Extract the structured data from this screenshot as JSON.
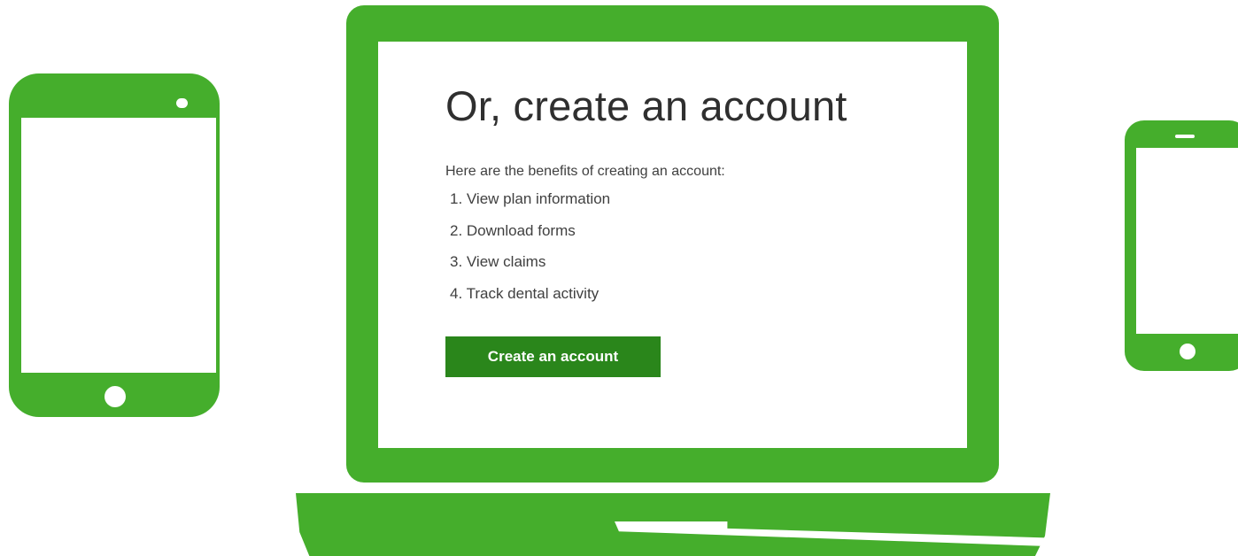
{
  "page": {
    "title": "Or, create an account",
    "intro": "Here are the benefits of creating an account:",
    "benefits": [
      "1. View plan information",
      "2. Download forms",
      "3. View claims",
      "4. Track dental activity"
    ],
    "cta_label": "Create an account"
  },
  "colors": {
    "device_green": "#45ae2c",
    "button_green": "#2a861b",
    "text": "#2f2f2f"
  },
  "icons": [
    "tablet-icon",
    "laptop-icon",
    "phone-icon"
  ]
}
